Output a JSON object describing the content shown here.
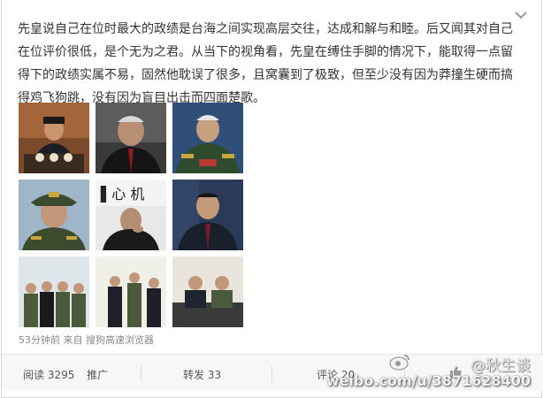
{
  "post": {
    "text": "先皇说自己在位时最大的政绩是台海之间实现高层交往，达成和解与和睦。后又闻其对自己在位评价很低，是个无为之君。从当下的视角看，先皇在缚住手脚的情况下，能取得一点留得下的政绩实属不易，固然他耽误了很多，且窝囊到了极致，但至少没有因为莽撞生硬而搞得鸡飞狗跳，没有因为盲目出击而四面楚歌。"
  },
  "meta": {
    "time": "53分钟前",
    "from_prefix": "来自",
    "source": "搜狗高速浏览器"
  },
  "actions": {
    "read_label": "阅读",
    "read_count": "3295",
    "promote_label": "推广",
    "repost_label": "转发",
    "repost_count": "33",
    "comment_label": "评论",
    "comment_count": "20"
  },
  "watermark": {
    "handle": "@秋生谈",
    "url": "weibo.com/u/3871628400"
  },
  "icons": {
    "chevron": "chevron-down-icon",
    "like": "thumbs-up-icon",
    "weibo_logo": "weibo-logo-icon"
  },
  "colors": {
    "text": "#333333",
    "meta": "#888888",
    "action_bar_bg": "#f7f7f7"
  }
}
